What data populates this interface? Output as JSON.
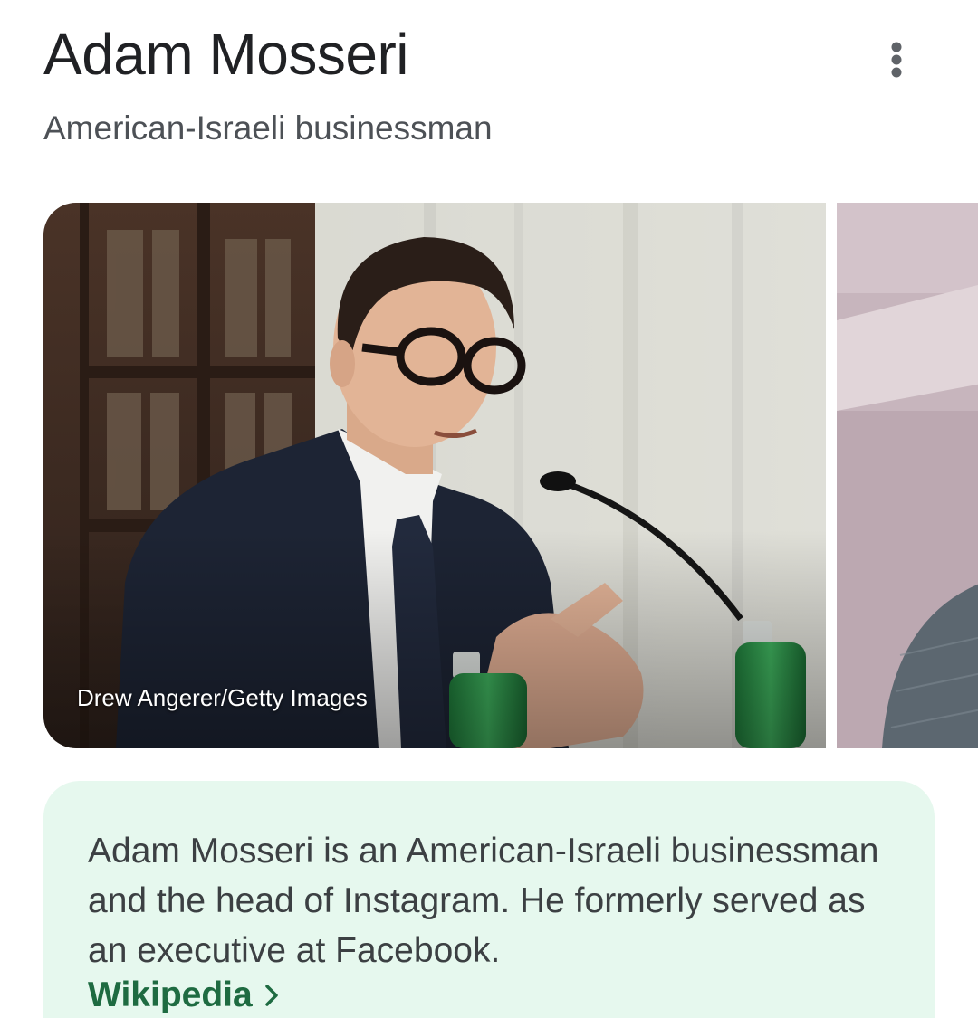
{
  "header": {
    "title": "Adam Mosseri",
    "subtitle": "American-Israeli businessman",
    "more_icon": "more-vert-icon"
  },
  "carousel": {
    "main_photo": {
      "credit": "Drew Angerer/Getty Images"
    }
  },
  "description": {
    "text": "Adam Mosseri is an American-Israeli businessman and the head of Instagram. He formerly served as an executive at Facebook.",
    "source_label": "Wikipedia",
    "source_icon": "chevron-right-icon"
  },
  "colors": {
    "card_background": "#e6f8ee",
    "link_green": "#1e6b41",
    "title_text": "#202124"
  }
}
